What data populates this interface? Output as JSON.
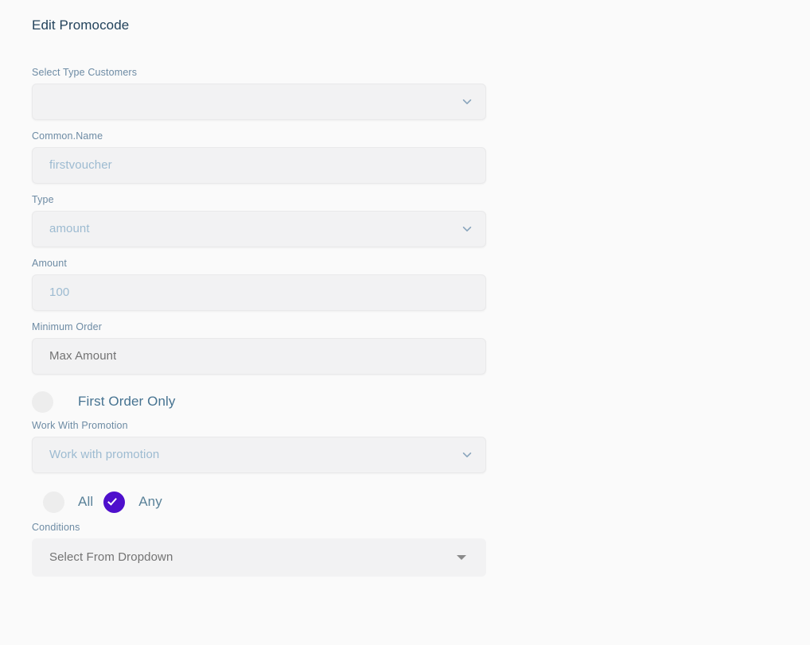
{
  "page": {
    "title": "Edit Promocode"
  },
  "theme": {
    "background": "#fafafa",
    "title_color": "#23435c",
    "label_color": "#6d8ba4",
    "field_bg": "#f2f2f3",
    "field_border": "#e9e9ea",
    "placeholder_blue": "#9dbbd1",
    "placeholder_grey": "#737373",
    "accent": "#4e0fcc",
    "radio_unchecked": "#ededed"
  },
  "form": {
    "select_type_customers": {
      "label": "Select Type Customers",
      "value": "",
      "icon": "chevron-down-icon"
    },
    "common_name": {
      "label": "Common.Name",
      "placeholder": "firstvoucher",
      "value": ""
    },
    "type": {
      "label": "Type",
      "placeholder": "amount",
      "value": "",
      "icon": "chevron-down-icon"
    },
    "amount": {
      "label": "Amount",
      "placeholder": "100",
      "value": ""
    },
    "minimum_order": {
      "label": "Minimum Order",
      "placeholder": "Max Amount",
      "value": ""
    },
    "first_order_only": {
      "label": "First Order Only",
      "checked": false
    },
    "work_with_promotion": {
      "label": "Work With Promotion",
      "placeholder": "Work with promotion",
      "value": "",
      "icon": "chevron-down-icon"
    },
    "match_mode": {
      "all_label": "All",
      "any_label": "Any",
      "selected": "Any"
    },
    "conditions": {
      "label": "Conditions",
      "placeholder": "Select From Dropdown",
      "value": "",
      "icon": "caret-down-icon"
    }
  }
}
